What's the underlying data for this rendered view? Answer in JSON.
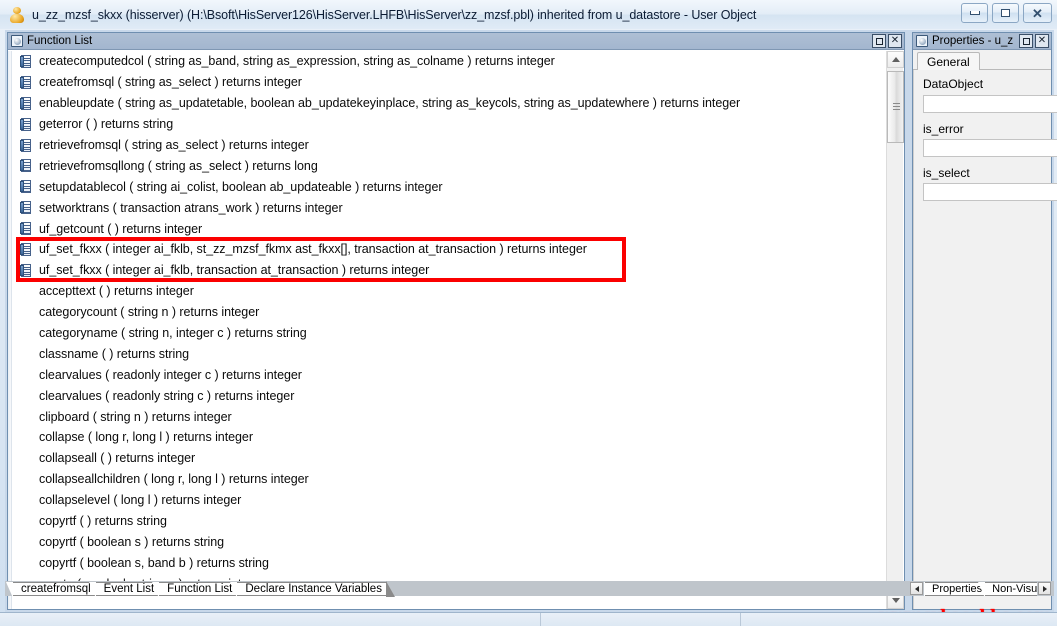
{
  "window": {
    "icon": "user-object-icon",
    "title": "u_zz_mzsf_skxx (hisserver) (H:\\Bsoft\\HisServer126\\HisServer.LHFB\\HisServer\\zz_mzsf.pbl) inherited from u_datastore - User Object",
    "buttons": [
      {
        "name": "minimize-button",
        "glyph": "minimize"
      },
      {
        "name": "restore-button",
        "glyph": "restore"
      },
      {
        "name": "close-button",
        "glyph": "close"
      }
    ]
  },
  "function_pane": {
    "caption": "Function List",
    "caption_buttons": [
      {
        "name": "maximize-button",
        "glyph": "square"
      },
      {
        "name": "close-button",
        "glyph": "X"
      }
    ],
    "rows": [
      {
        "icon": true,
        "text": "createcomputedcol ( string as_band, string as_expression, string as_colname )  returns integer"
      },
      {
        "icon": true,
        "text": "createfromsql ( string as_select )  returns integer"
      },
      {
        "icon": true,
        "text": "enableupdate ( string as_updatetable, boolean ab_updatekeyinplace, string as_keycols, string as_updatewhere )  returns integer"
      },
      {
        "icon": true,
        "text": "geterror ( )  returns string"
      },
      {
        "icon": true,
        "text": "retrievefromsql ( string as_select )  returns integer"
      },
      {
        "icon": true,
        "text": "retrievefromsqllong ( string as_select )  returns long"
      },
      {
        "icon": true,
        "text": "setupdatablecol ( string ai_colist, boolean ab_updateable )  returns integer"
      },
      {
        "icon": true,
        "text": "setworktrans ( transaction atrans_work )  returns integer"
      },
      {
        "icon": true,
        "text": "uf_getcount ( )  returns integer"
      },
      {
        "icon": true,
        "text": "uf_set_fkxx ( integer ai_fklb, st_zz_mzsf_fkmx ast_fkxx[], transaction at_transaction )  returns integer",
        "highlighted": true
      },
      {
        "icon": true,
        "text": "uf_set_fkxx ( integer ai_fklb, transaction at_transaction )  returns integer",
        "highlighted": true
      },
      {
        "icon": false,
        "text": "accepttext ( )  returns integer"
      },
      {
        "icon": false,
        "text": "categorycount ( string n )  returns integer"
      },
      {
        "icon": false,
        "text": "categoryname ( string n, integer c )  returns string"
      },
      {
        "icon": false,
        "text": "classname ( )  returns string"
      },
      {
        "icon": false,
        "text": "clearvalues ( readonly integer c )  returns integer"
      },
      {
        "icon": false,
        "text": "clearvalues ( readonly string c )  returns integer"
      },
      {
        "icon": false,
        "text": "clipboard ( string n )  returns integer"
      },
      {
        "icon": false,
        "text": "collapse ( long r, long l )  returns integer"
      },
      {
        "icon": false,
        "text": "collapseall ( )  returns integer"
      },
      {
        "icon": false,
        "text": "collapseallchildren ( long r, long l )  returns integer"
      },
      {
        "icon": false,
        "text": "collapselevel ( long l )  returns integer"
      },
      {
        "icon": false,
        "text": "copyrtf ( )  returns string"
      },
      {
        "icon": false,
        "text": "copyrtf ( boolean s )  returns string"
      },
      {
        "icon": false,
        "text": "copyrtf ( boolean s, band b )  returns string"
      },
      {
        "icon": false,
        "text": "create ( readonly string s )  returns integer"
      }
    ],
    "highlight_color": "#fb0000",
    "scrollbar": {
      "up": "scroll-up",
      "down": "scroll-down"
    }
  },
  "properties_pane": {
    "caption": "Properties - u_z",
    "caption_buttons": [
      {
        "name": "maximize-button",
        "glyph": "square"
      },
      {
        "name": "close-button",
        "glyph": "X"
      }
    ],
    "tab": "General",
    "fields": [
      {
        "label": "DataObject",
        "value": "",
        "has_browse": true,
        "browse_label": "..."
      },
      {
        "label": "is_error",
        "value": "",
        "has_browse": false
      },
      {
        "label": "is_select",
        "value": "",
        "has_browse": false
      }
    ]
  },
  "bottom_tabs": [
    {
      "label": "createfromsql"
    },
    {
      "label": "Event List"
    },
    {
      "label": "Function List"
    },
    {
      "label": "Declare Instance Variables"
    }
  ],
  "properties_bottom_tabs": [
    {
      "label": "Properties"
    },
    {
      "label": "Non-Visu"
    }
  ],
  "watermark": "www.sybasebbs.com"
}
